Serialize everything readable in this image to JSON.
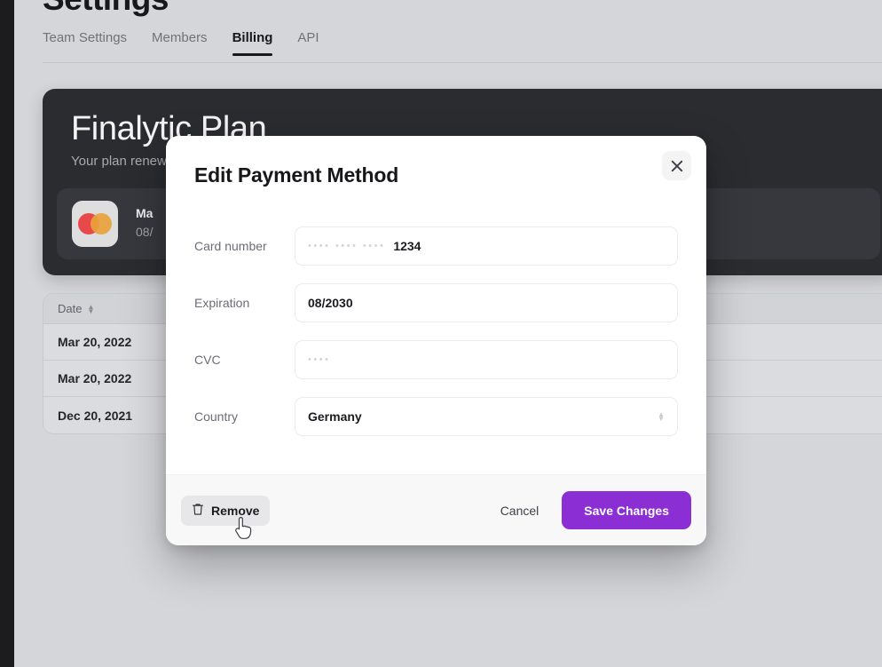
{
  "page": {
    "title": "Settings",
    "tabs": [
      {
        "label": "Team Settings",
        "active": false
      },
      {
        "label": "Members",
        "active": false
      },
      {
        "label": "Billing",
        "active": true
      },
      {
        "label": "API",
        "active": false
      }
    ]
  },
  "plan_card": {
    "name": "Finalytic Plan",
    "renewal_text": "Your plan renews",
    "payment_method": {
      "brand_icon": "mastercard-icon",
      "brand_label": "Ma",
      "expiry_label": "08/"
    }
  },
  "invoice_table": {
    "columns": [
      {
        "label": "Date",
        "sort_icon": "sort-updown-icon"
      }
    ],
    "rows": [
      {
        "date": "Mar 20, 2022"
      },
      {
        "date": "Mar 20, 2022"
      },
      {
        "date": "Dec 20, 2021"
      }
    ]
  },
  "modal": {
    "title": "Edit Payment Method",
    "close_icon": "close-icon",
    "fields": {
      "card_number": {
        "label": "Card number",
        "masked_groups": "••••  ••••  ••••",
        "value": "1234"
      },
      "expiration": {
        "label": "Expiration",
        "value": "08/2030"
      },
      "cvc": {
        "label": "CVC",
        "value": "",
        "placeholder_dots": "••••"
      },
      "country": {
        "label": "Country",
        "value": "Germany",
        "caret_icon": "chevron-updown-icon"
      }
    },
    "footer": {
      "remove_label": "Remove",
      "remove_icon": "trash-icon",
      "cancel_label": "Cancel",
      "save_label": "Save Changes"
    }
  },
  "colors": {
    "accent": "#8b2fd4",
    "page_background": "#d5d6d9",
    "card_background": "#2b2c30",
    "sidebar_rail": "#1c1c1f"
  }
}
